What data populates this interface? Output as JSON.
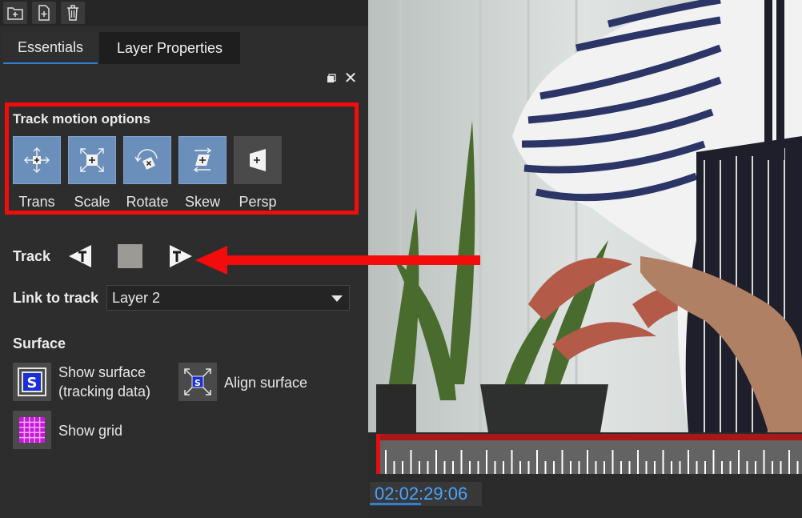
{
  "toolbar": {
    "buttons": [
      "new-folder-icon",
      "new-file-icon",
      "trash-icon"
    ]
  },
  "tabs": [
    {
      "label": "Essentials",
      "active": true
    },
    {
      "label": "Layer Properties",
      "active": false
    }
  ],
  "track_motion": {
    "title": "Track motion options",
    "options": [
      {
        "label": "Trans",
        "icon": "translate-icon",
        "active": true
      },
      {
        "label": "Scale",
        "icon": "scale-icon",
        "active": true
      },
      {
        "label": "Rotate",
        "icon": "rotate-icon",
        "active": true
      },
      {
        "label": "Skew",
        "icon": "skew-icon",
        "active": true
      },
      {
        "label": "Persp",
        "icon": "perspective-icon",
        "active": false
      }
    ]
  },
  "track": {
    "label": "Track",
    "back_icon": "track-backward-icon",
    "stop_icon": "stop-icon",
    "forward_icon": "track-forward-icon"
  },
  "link": {
    "label": "Link to track",
    "value": "Layer 2"
  },
  "surface": {
    "label": "Surface",
    "show_surface": "Show surface",
    "show_surface_sub": "(tracking data)",
    "align_surface": "Align surface",
    "show_grid": "Show grid"
  },
  "timeline": {
    "timecode": "02:02:29:06"
  },
  "colors": {
    "accent": "#2f7fd4",
    "highlight": "#f20c0c",
    "motion_button": "#6a8fba",
    "timecode": "#4aa3ff"
  }
}
